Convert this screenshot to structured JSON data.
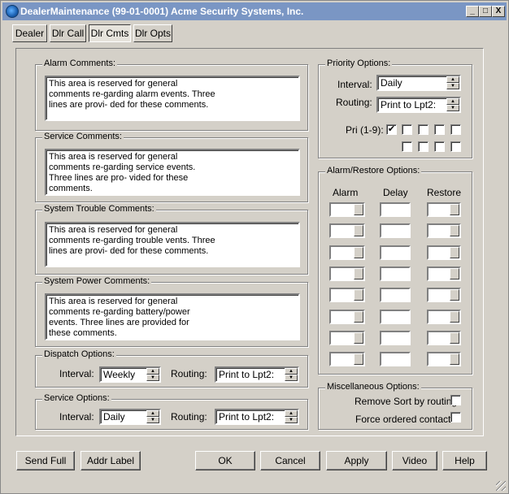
{
  "window": {
    "title": "DealerMaintenance (99-01-0001) Acme Security Systems, Inc.",
    "min": "_",
    "max": "□",
    "close": "X"
  },
  "tabs": [
    {
      "label": "Dealer",
      "active": false
    },
    {
      "label": "Dlr Call",
      "active": false
    },
    {
      "label": "Dlr Cmts",
      "active": true
    },
    {
      "label": "Dlr Opts",
      "active": false
    }
  ],
  "comments": {
    "alarm": {
      "label": "Alarm Comments:",
      "lines": [
        "This area is reserved for general",
        "comments re-garding alarm events. Three",
        "lines are provi-  ded for these comments."
      ]
    },
    "service": {
      "label": "Service Comments:",
      "lines": [
        "This area is reserved for general",
        "comments re-garding service events.",
        "Three lines are pro-  vided for these",
        "comments."
      ]
    },
    "trouble": {
      "label": "System Trouble Comments:",
      "lines": [
        "This area is reserved for general",
        "comments re-garding trouble vents. Three",
        "lines are provi-  ded for these comments."
      ]
    },
    "power": {
      "label": "System Power Comments:",
      "lines": [
        "This area is reserved for general",
        "comments re-garding battery/power",
        "events. Three lines are provided for",
        "these comments."
      ]
    }
  },
  "dispatch": {
    "label": "Dispatch Options:",
    "interval_label": "Interval:",
    "interval": "Weekly",
    "routing_label": "Routing:",
    "routing": "Print to Lpt2:"
  },
  "service_opts": {
    "label": "Service Options:",
    "interval_label": "Interval:",
    "interval": "Daily",
    "routing_label": "Routing:",
    "routing": "Print to Lpt2:"
  },
  "priority": {
    "label": "Priority Options:",
    "interval_label": "Interval:",
    "interval": "Daily",
    "routing_label": "Routing:",
    "routing": "Print to Lpt2:",
    "pri_label": "Pri (1-9):",
    "checked": [
      true,
      false,
      false,
      false,
      false,
      false,
      false,
      false,
      false
    ]
  },
  "alarm_restore": {
    "label": "Alarm/Restore Options:",
    "col_alarm": "Alarm",
    "col_delay": "Delay",
    "col_restore": "Restore",
    "rows": 8
  },
  "misc": {
    "label": "Miscellaneous Options:",
    "remove_sort": "Remove Sort by routing",
    "remove_sort_checked": false,
    "force_ordered": "Force ordered contacts",
    "force_ordered_checked": false
  },
  "buttons": {
    "send_full": "Send Full",
    "addr_label": "Addr Label",
    "ok": "OK",
    "cancel": "Cancel",
    "apply": "Apply",
    "video": "Video",
    "help": "Help"
  },
  "icons": {
    "app": "globe-icon",
    "spin_up": "up-arrow-icon",
    "spin_down": "down-arrow-icon",
    "check": "check-icon"
  }
}
